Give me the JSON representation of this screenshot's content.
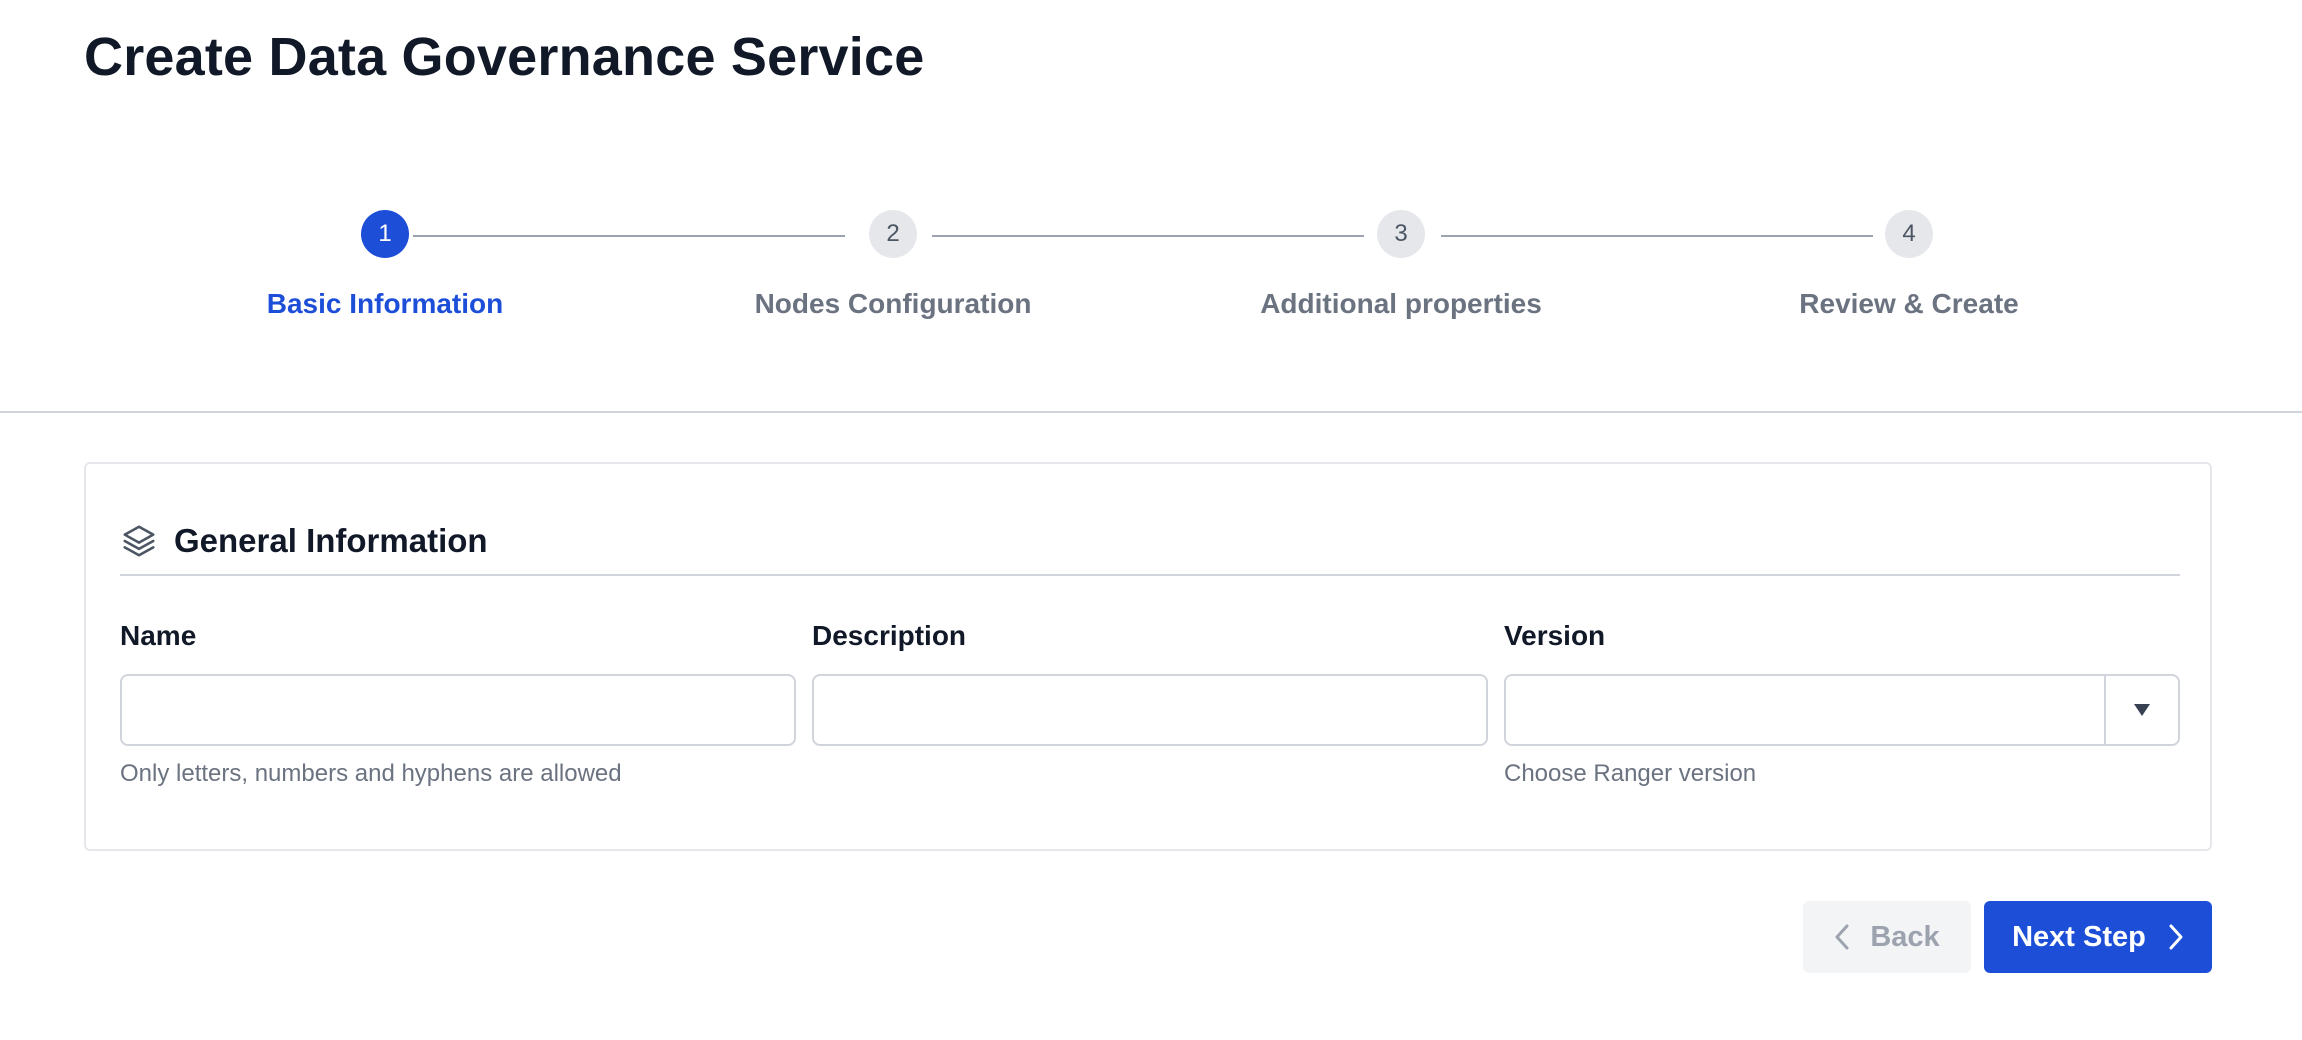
{
  "page": {
    "title": "Create Data Governance Service"
  },
  "stepper": {
    "steps": [
      {
        "number": "1",
        "label": "Basic Information",
        "active": true
      },
      {
        "number": "2",
        "label": "Nodes Configuration",
        "active": false
      },
      {
        "number": "3",
        "label": "Additional properties",
        "active": false
      },
      {
        "number": "4",
        "label": "Review & Create",
        "active": false
      }
    ]
  },
  "general_information": {
    "title": "General Information",
    "icon": "layers-icon",
    "name": {
      "label": "Name",
      "value": "",
      "placeholder": "",
      "hint": "Only letters, numbers and hyphens are allowed"
    },
    "description": {
      "label": "Description",
      "value": "",
      "placeholder": ""
    },
    "version": {
      "label": "Version",
      "selected": "",
      "hint": "Choose Ranger version",
      "toggle_icon": "caret-down-icon"
    }
  },
  "actions": {
    "back_label": "Back",
    "back_icon": "chevron-left-icon",
    "next_label": "Next Step",
    "next_icon": "chevron-right-icon"
  },
  "colors": {
    "primary": "#1d4ed8",
    "muted_text": "#6b7280",
    "border": "#d1d5db",
    "disabled_bg": "#f3f4f6"
  }
}
